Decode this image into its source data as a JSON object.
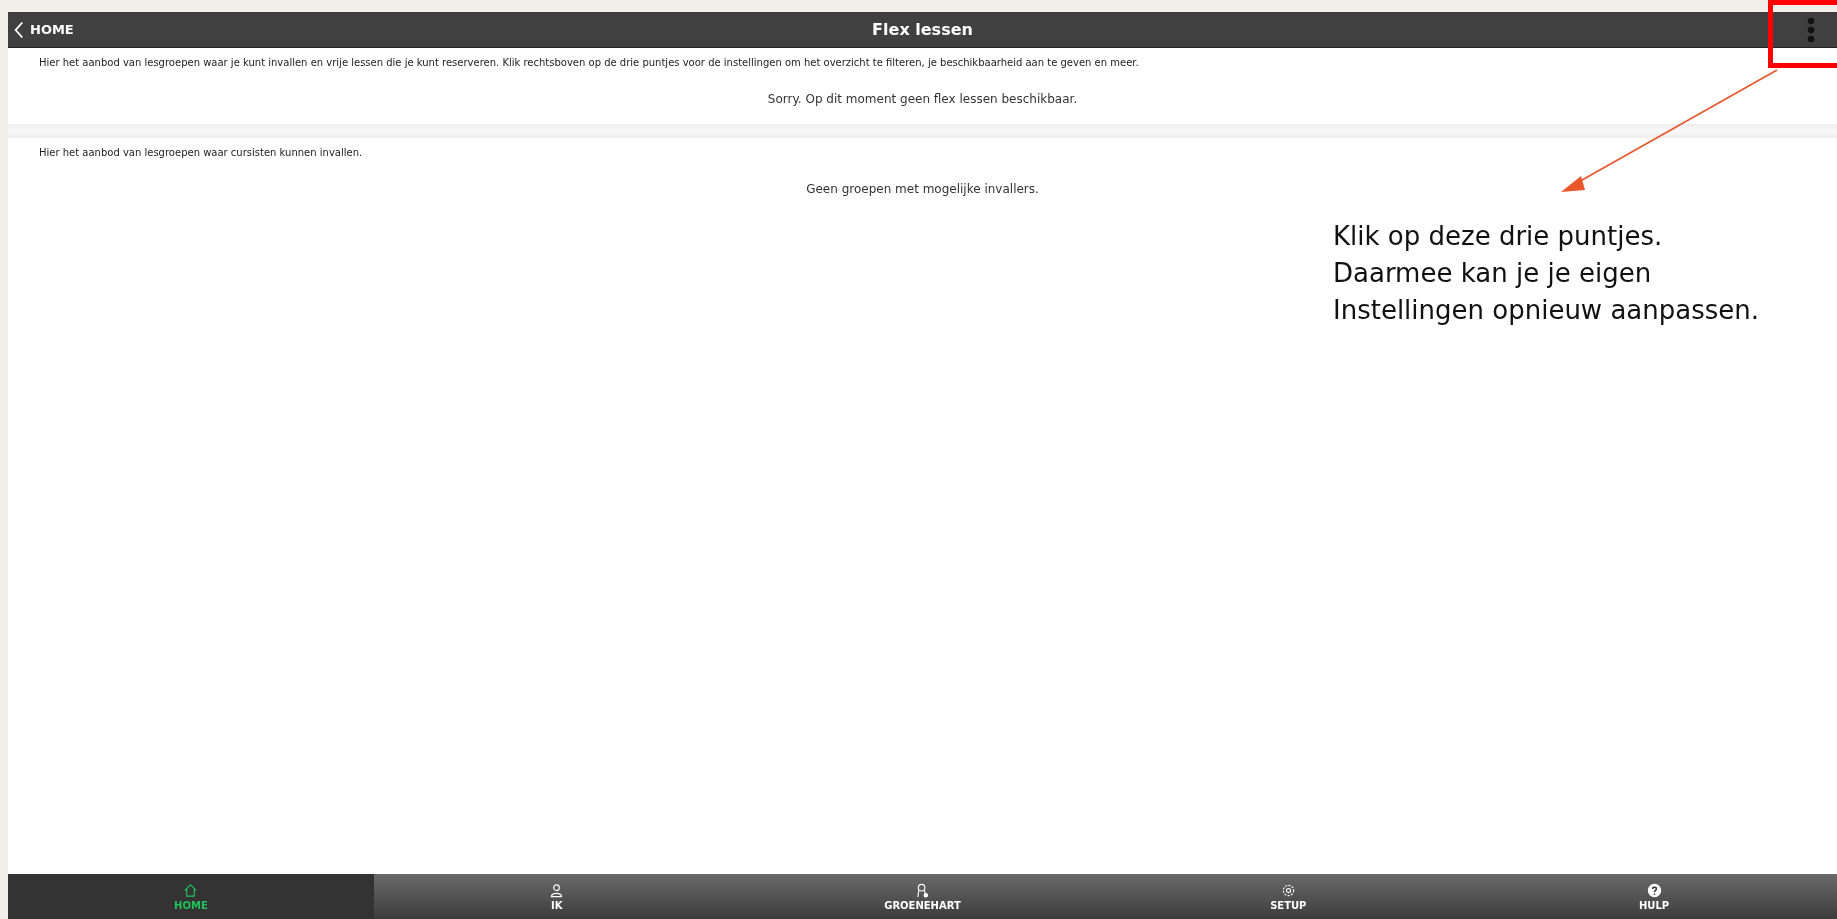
{
  "header": {
    "back_label": "HOME",
    "title": "Flex lessen"
  },
  "sections": [
    {
      "intro": "Hier het aanbod van lesgroepen waar je kunt invallen en vrije lessen die je kunt reserveren. Klik rechtsboven op de drie puntjes voor de instellingen om het overzicht te filteren, je beschikbaarheid aan te geven en meer.",
      "message": "Sorry. Op dit moment geen flex lessen beschikbaar."
    },
    {
      "intro": "Hier het aanbod van lesgroepen waar cursisten kunnen invallen.",
      "message": "Geen groepen met mogelijke invallers."
    }
  ],
  "annotation": {
    "lines": [
      "Klik op deze drie puntjes.",
      "Daarmee kan je je eigen",
      "Instellingen opnieuw aanpassen."
    ]
  },
  "nav": [
    {
      "label": "HOME",
      "kind": "home",
      "selected": true
    },
    {
      "label": "IK",
      "kind": "person",
      "selected": false
    },
    {
      "label": "GROENEHART",
      "kind": "pin",
      "selected": false
    },
    {
      "label": "SETUP",
      "kind": "gear",
      "selected": false
    },
    {
      "label": "HULP",
      "kind": "help",
      "selected": false
    }
  ]
}
